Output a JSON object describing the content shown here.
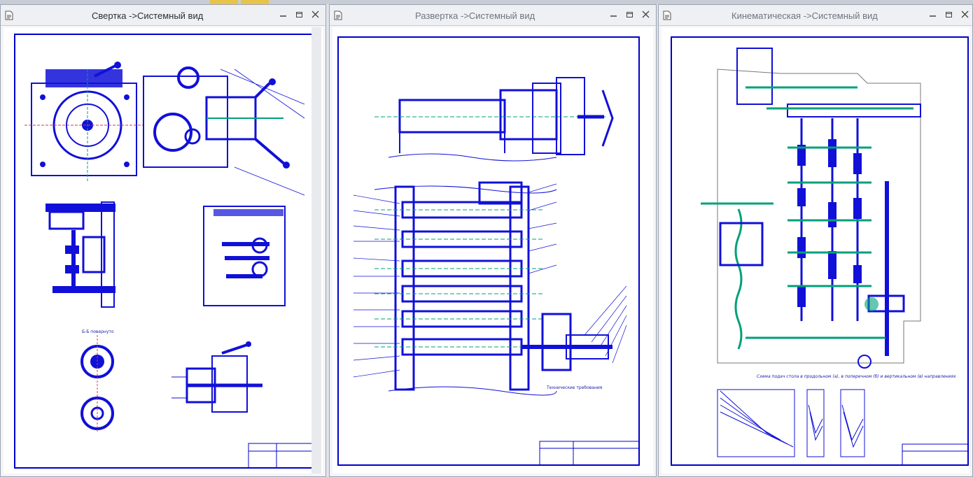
{
  "windows": [
    {
      "title": "Свертка ->Системный вид",
      "active": true
    },
    {
      "title": "Развертка ->Системный вид",
      "active": false
    },
    {
      "title": "Кинематическая ->Системный вид",
      "active": false
    }
  ],
  "annotations": {
    "w1_section_label": "Б-Б повернуто",
    "w3_chart_caption": "Схема подач стола в продольном (а), в поперечном (б) и вертикальном (в) направлениях"
  },
  "colors": {
    "line": "#1010d8",
    "accent_green": "#00a07a",
    "frame": "#0000cc"
  },
  "icons": {
    "document": "document-icon",
    "minimize": "minimize-icon",
    "restore": "restore-icon",
    "close": "close-icon"
  }
}
